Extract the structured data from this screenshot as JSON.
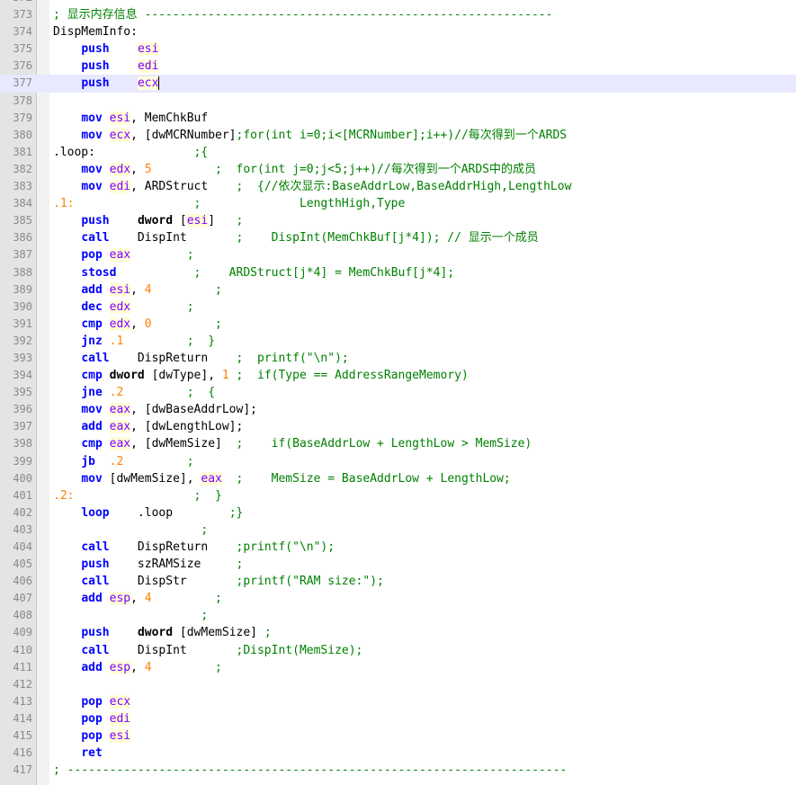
{
  "editor": {
    "lines": [
      {
        "n": "372",
        "tokens": []
      },
      {
        "n": "373",
        "tokens": [
          {
            "t": "cm",
            "v": "; 显示内存信息 ----------------------------------------------------------"
          }
        ]
      },
      {
        "n": "374",
        "tokens": [
          {
            "t": "tx",
            "v": "DispMemInfo:"
          }
        ]
      },
      {
        "n": "375",
        "tokens": [
          {
            "t": "tx",
            "v": "    "
          },
          {
            "t": "kw",
            "v": "push"
          },
          {
            "t": "tx",
            "v": "    "
          },
          {
            "t": "reg",
            "v": "esi"
          }
        ]
      },
      {
        "n": "376",
        "tokens": [
          {
            "t": "tx",
            "v": "    "
          },
          {
            "t": "kw",
            "v": "push"
          },
          {
            "t": "tx",
            "v": "    "
          },
          {
            "t": "reg",
            "v": "edi"
          }
        ]
      },
      {
        "n": "377",
        "current": true,
        "tokens": [
          {
            "t": "tx",
            "v": "    "
          },
          {
            "t": "kw",
            "v": "push"
          },
          {
            "t": "tx",
            "v": "    "
          },
          {
            "t": "reg",
            "v": "ecx"
          },
          {
            "t": "caret",
            "v": ""
          }
        ]
      },
      {
        "n": "378",
        "tokens": []
      },
      {
        "n": "379",
        "tokens": [
          {
            "t": "tx",
            "v": "    "
          },
          {
            "t": "kw",
            "v": "mov"
          },
          {
            "t": "tx",
            "v": " "
          },
          {
            "t": "reg",
            "v": "esi"
          },
          {
            "t": "tx",
            "v": ", MemChkBuf"
          }
        ]
      },
      {
        "n": "380",
        "tokens": [
          {
            "t": "tx",
            "v": "    "
          },
          {
            "t": "kw",
            "v": "mov"
          },
          {
            "t": "tx",
            "v": " "
          },
          {
            "t": "reg",
            "v": "ecx"
          },
          {
            "t": "tx",
            "v": ", [dwMCRNumber]"
          },
          {
            "t": "cm",
            "v": ";for(int i=0;i<[MCRNumber];i++)//每次得到一个ARDS"
          }
        ]
      },
      {
        "n": "381",
        "tokens": [
          {
            "t": "tx",
            "v": ".loop:"
          },
          {
            "t": "cm",
            "v": "              ;{"
          }
        ]
      },
      {
        "n": "382",
        "tokens": [
          {
            "t": "tx",
            "v": "    "
          },
          {
            "t": "kw",
            "v": "mov"
          },
          {
            "t": "tx",
            "v": " "
          },
          {
            "t": "reg",
            "v": "edx"
          },
          {
            "t": "tx",
            "v": ", "
          },
          {
            "t": "num",
            "v": "5"
          },
          {
            "t": "cm",
            "v": "         ;  for(int j=0;j<5;j++)//每次得到一个ARDS中的成员"
          }
        ]
      },
      {
        "n": "383",
        "tokens": [
          {
            "t": "tx",
            "v": "    "
          },
          {
            "t": "kw",
            "v": "mov"
          },
          {
            "t": "tx",
            "v": " "
          },
          {
            "t": "reg",
            "v": "edi"
          },
          {
            "t": "tx",
            "v": ", ARDStruct"
          },
          {
            "t": "cm",
            "v": "    ;  {//依次显示:BaseAddrLow,BaseAddrHigh,LengthLow"
          }
        ]
      },
      {
        "n": "384",
        "tokens": [
          {
            "t": "lbl",
            "v": ".1:"
          },
          {
            "t": "cm",
            "v": "                 ;              LengthHigh,Type"
          }
        ]
      },
      {
        "n": "385",
        "tokens": [
          {
            "t": "tx",
            "v": "    "
          },
          {
            "t": "kw",
            "v": "push"
          },
          {
            "t": "tx",
            "v": "    "
          },
          {
            "t": "op",
            "v": "dword"
          },
          {
            "t": "tx",
            "v": " ["
          },
          {
            "t": "reg",
            "v": "esi"
          },
          {
            "t": "tx",
            "v": "]"
          },
          {
            "t": "cm",
            "v": "   ;"
          }
        ]
      },
      {
        "n": "386",
        "tokens": [
          {
            "t": "tx",
            "v": "    "
          },
          {
            "t": "kw",
            "v": "call"
          },
          {
            "t": "tx",
            "v": "    DispInt"
          },
          {
            "t": "cm",
            "v": "       ;    DispInt(MemChkBuf[j*4]); // 显示一个成员"
          }
        ]
      },
      {
        "n": "387",
        "tokens": [
          {
            "t": "tx",
            "v": "    "
          },
          {
            "t": "kw",
            "v": "pop"
          },
          {
            "t": "tx",
            "v": " "
          },
          {
            "t": "reg",
            "v": "eax"
          },
          {
            "t": "cm",
            "v": "        ;"
          }
        ]
      },
      {
        "n": "388",
        "tokens": [
          {
            "t": "tx",
            "v": "    "
          },
          {
            "t": "kw",
            "v": "stosd"
          },
          {
            "t": "cm",
            "v": "           ;    ARDStruct[j*4] = MemChkBuf[j*4];"
          }
        ]
      },
      {
        "n": "389",
        "tokens": [
          {
            "t": "tx",
            "v": "    "
          },
          {
            "t": "kw",
            "v": "add"
          },
          {
            "t": "tx",
            "v": " "
          },
          {
            "t": "reg",
            "v": "esi"
          },
          {
            "t": "tx",
            "v": ", "
          },
          {
            "t": "num",
            "v": "4"
          },
          {
            "t": "cm",
            "v": "         ;"
          }
        ]
      },
      {
        "n": "390",
        "tokens": [
          {
            "t": "tx",
            "v": "    "
          },
          {
            "t": "kw",
            "v": "dec"
          },
          {
            "t": "tx",
            "v": " "
          },
          {
            "t": "reg",
            "v": "edx"
          },
          {
            "t": "cm",
            "v": "        ;"
          }
        ]
      },
      {
        "n": "391",
        "tokens": [
          {
            "t": "tx",
            "v": "    "
          },
          {
            "t": "kw",
            "v": "cmp"
          },
          {
            "t": "tx",
            "v": " "
          },
          {
            "t": "reg",
            "v": "edx"
          },
          {
            "t": "tx",
            "v": ", "
          },
          {
            "t": "num",
            "v": "0"
          },
          {
            "t": "cm",
            "v": "         ;"
          }
        ]
      },
      {
        "n": "392",
        "tokens": [
          {
            "t": "tx",
            "v": "    "
          },
          {
            "t": "kw",
            "v": "jnz"
          },
          {
            "t": "tx",
            "v": " "
          },
          {
            "t": "lbl",
            "v": ".1"
          },
          {
            "t": "cm",
            "v": "         ;  }"
          }
        ]
      },
      {
        "n": "393",
        "tokens": [
          {
            "t": "tx",
            "v": "    "
          },
          {
            "t": "kw",
            "v": "call"
          },
          {
            "t": "tx",
            "v": "    DispReturn"
          },
          {
            "t": "cm",
            "v": "    ;  printf(\"\\n\");"
          }
        ]
      },
      {
        "n": "394",
        "tokens": [
          {
            "t": "tx",
            "v": "    "
          },
          {
            "t": "kw",
            "v": "cmp"
          },
          {
            "t": "tx",
            "v": " "
          },
          {
            "t": "op",
            "v": "dword"
          },
          {
            "t": "tx",
            "v": " [dwType], "
          },
          {
            "t": "num",
            "v": "1"
          },
          {
            "t": "cm",
            "v": " ;  if(Type == AddressRangeMemory)"
          }
        ]
      },
      {
        "n": "395",
        "tokens": [
          {
            "t": "tx",
            "v": "    "
          },
          {
            "t": "kw",
            "v": "jne"
          },
          {
            "t": "tx",
            "v": " "
          },
          {
            "t": "lbl",
            "v": ".2"
          },
          {
            "t": "cm",
            "v": "         ;  {"
          }
        ]
      },
      {
        "n": "396",
        "tokens": [
          {
            "t": "tx",
            "v": "    "
          },
          {
            "t": "kw",
            "v": "mov"
          },
          {
            "t": "tx",
            "v": " "
          },
          {
            "t": "reg",
            "v": "eax"
          },
          {
            "t": "tx",
            "v": ", [dwBaseAddrLow];"
          }
        ]
      },
      {
        "n": "397",
        "tokens": [
          {
            "t": "tx",
            "v": "    "
          },
          {
            "t": "kw",
            "v": "add"
          },
          {
            "t": "tx",
            "v": " "
          },
          {
            "t": "reg",
            "v": "eax"
          },
          {
            "t": "tx",
            "v": ", [dwLengthLow];"
          }
        ]
      },
      {
        "n": "398",
        "tokens": [
          {
            "t": "tx",
            "v": "    "
          },
          {
            "t": "kw",
            "v": "cmp"
          },
          {
            "t": "tx",
            "v": " "
          },
          {
            "t": "reg",
            "v": "eax"
          },
          {
            "t": "tx",
            "v": ", [dwMemSize]"
          },
          {
            "t": "cm",
            "v": "  ;    if(BaseAddrLow + LengthLow > MemSize)"
          }
        ]
      },
      {
        "n": "399",
        "tokens": [
          {
            "t": "tx",
            "v": "    "
          },
          {
            "t": "kw",
            "v": "jb"
          },
          {
            "t": "tx",
            "v": "  "
          },
          {
            "t": "lbl",
            "v": ".2"
          },
          {
            "t": "cm",
            "v": "         ;"
          }
        ]
      },
      {
        "n": "400",
        "tokens": [
          {
            "t": "tx",
            "v": "    "
          },
          {
            "t": "kw",
            "v": "mov"
          },
          {
            "t": "tx",
            "v": " [dwMemSize], "
          },
          {
            "t": "reg",
            "v": "eax"
          },
          {
            "t": "cm",
            "v": "  ;    MemSize = BaseAddrLow + LengthLow;"
          }
        ]
      },
      {
        "n": "401",
        "tokens": [
          {
            "t": "lbl",
            "v": ".2:"
          },
          {
            "t": "cm",
            "v": "                 ;  }"
          }
        ]
      },
      {
        "n": "402",
        "tokens": [
          {
            "t": "tx",
            "v": "    "
          },
          {
            "t": "kw",
            "v": "loop"
          },
          {
            "t": "tx",
            "v": "    .loop"
          },
          {
            "t": "cm",
            "v": "        ;}"
          }
        ]
      },
      {
        "n": "403",
        "tokens": [
          {
            "t": "cm",
            "v": "                     ;"
          }
        ]
      },
      {
        "n": "404",
        "tokens": [
          {
            "t": "tx",
            "v": "    "
          },
          {
            "t": "kw",
            "v": "call"
          },
          {
            "t": "tx",
            "v": "    DispReturn"
          },
          {
            "t": "cm",
            "v": "    ;printf(\"\\n\");"
          }
        ]
      },
      {
        "n": "405",
        "tokens": [
          {
            "t": "tx",
            "v": "    "
          },
          {
            "t": "kw",
            "v": "push"
          },
          {
            "t": "tx",
            "v": "    szRAMSize"
          },
          {
            "t": "cm",
            "v": "     ;"
          }
        ]
      },
      {
        "n": "406",
        "tokens": [
          {
            "t": "tx",
            "v": "    "
          },
          {
            "t": "kw",
            "v": "call"
          },
          {
            "t": "tx",
            "v": "    DispStr"
          },
          {
            "t": "cm",
            "v": "       ;printf(\"RAM size:\");"
          }
        ]
      },
      {
        "n": "407",
        "tokens": [
          {
            "t": "tx",
            "v": "    "
          },
          {
            "t": "kw",
            "v": "add"
          },
          {
            "t": "tx",
            "v": " "
          },
          {
            "t": "reg",
            "v": "esp"
          },
          {
            "t": "tx",
            "v": ", "
          },
          {
            "t": "num",
            "v": "4"
          },
          {
            "t": "cm",
            "v": "         ;"
          }
        ]
      },
      {
        "n": "408",
        "tokens": [
          {
            "t": "cm",
            "v": "                     ;"
          }
        ]
      },
      {
        "n": "409",
        "tokens": [
          {
            "t": "tx",
            "v": "    "
          },
          {
            "t": "kw",
            "v": "push"
          },
          {
            "t": "tx",
            "v": "    "
          },
          {
            "t": "op",
            "v": "dword"
          },
          {
            "t": "tx",
            "v": " [dwMemSize]"
          },
          {
            "t": "cm",
            "v": " ;"
          }
        ]
      },
      {
        "n": "410",
        "tokens": [
          {
            "t": "tx",
            "v": "    "
          },
          {
            "t": "kw",
            "v": "call"
          },
          {
            "t": "tx",
            "v": "    DispInt"
          },
          {
            "t": "cm",
            "v": "       ;DispInt(MemSize);"
          }
        ]
      },
      {
        "n": "411",
        "tokens": [
          {
            "t": "tx",
            "v": "    "
          },
          {
            "t": "kw",
            "v": "add"
          },
          {
            "t": "tx",
            "v": " "
          },
          {
            "t": "reg",
            "v": "esp"
          },
          {
            "t": "tx",
            "v": ", "
          },
          {
            "t": "num",
            "v": "4"
          },
          {
            "t": "cm",
            "v": "         ;"
          }
        ]
      },
      {
        "n": "412",
        "tokens": []
      },
      {
        "n": "413",
        "tokens": [
          {
            "t": "tx",
            "v": "    "
          },
          {
            "t": "kw",
            "v": "pop"
          },
          {
            "t": "tx",
            "v": " "
          },
          {
            "t": "reg",
            "v": "ecx"
          }
        ]
      },
      {
        "n": "414",
        "tokens": [
          {
            "t": "tx",
            "v": "    "
          },
          {
            "t": "kw",
            "v": "pop"
          },
          {
            "t": "tx",
            "v": " "
          },
          {
            "t": "reg",
            "v": "edi"
          }
        ]
      },
      {
        "n": "415",
        "tokens": [
          {
            "t": "tx",
            "v": "    "
          },
          {
            "t": "kw",
            "v": "pop"
          },
          {
            "t": "tx",
            "v": " "
          },
          {
            "t": "reg",
            "v": "esi"
          }
        ]
      },
      {
        "n": "416",
        "tokens": [
          {
            "t": "tx",
            "v": "    "
          },
          {
            "t": "kw",
            "v": "ret"
          }
        ]
      },
      {
        "n": "417",
        "tokens": [
          {
            "t": "cm",
            "v": "; -----------------------------------------------------------------------"
          }
        ]
      }
    ]
  },
  "colors": {
    "keyword": "#0000ff",
    "register": "#8000ff",
    "register_bg": "#fffdd8",
    "number": "#ff8000",
    "comment": "#008000",
    "current_line": "#e8e8ff",
    "gutter": "#e4e4e4"
  }
}
